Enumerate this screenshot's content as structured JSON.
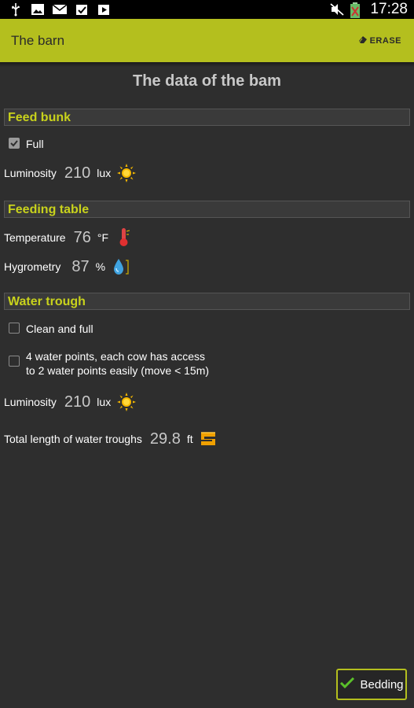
{
  "status_bar": {
    "time": "17:28",
    "icons_left": [
      "usb-icon",
      "image-icon",
      "mail-icon",
      "store-icon",
      "play-store-icon"
    ],
    "icons_right": [
      "mute-icon",
      "battery-icon"
    ]
  },
  "action_bar": {
    "title": "The barn",
    "erase_label": "ERASE"
  },
  "page_title": "The data of the bam",
  "sections": {
    "feed_bunk": {
      "header": "Feed bunk",
      "full_label": "Full",
      "full_checked": true,
      "luminosity_label": "Luminosity",
      "luminosity_value": "210",
      "luminosity_unit": "lux"
    },
    "feeding_table": {
      "header": "Feeding table",
      "temperature_label": "Temperature",
      "temperature_value": "76",
      "temperature_unit": "°F",
      "hygrometry_label": "Hygrometry",
      "hygrometry_value": "87",
      "hygrometry_unit": "%"
    },
    "water_trough": {
      "header": "Water trough",
      "clean_label": "Clean and full",
      "clean_checked": false,
      "water_points_line1": "4 water points, each cow has access",
      "water_points_line2": "to 2 water points easily (move < 15m)",
      "water_points_checked": false,
      "luminosity_label": "Luminosity",
      "luminosity_value": "210",
      "luminosity_unit": "lux",
      "length_label": "Total length of water troughs",
      "length_value": "29.8",
      "length_unit": "ft"
    }
  },
  "bedding_button": {
    "label": "Bedding"
  },
  "colors": {
    "accent": "#b4bf1e",
    "section_header_text": "#c8d21c",
    "background": "#2e2e2e"
  }
}
